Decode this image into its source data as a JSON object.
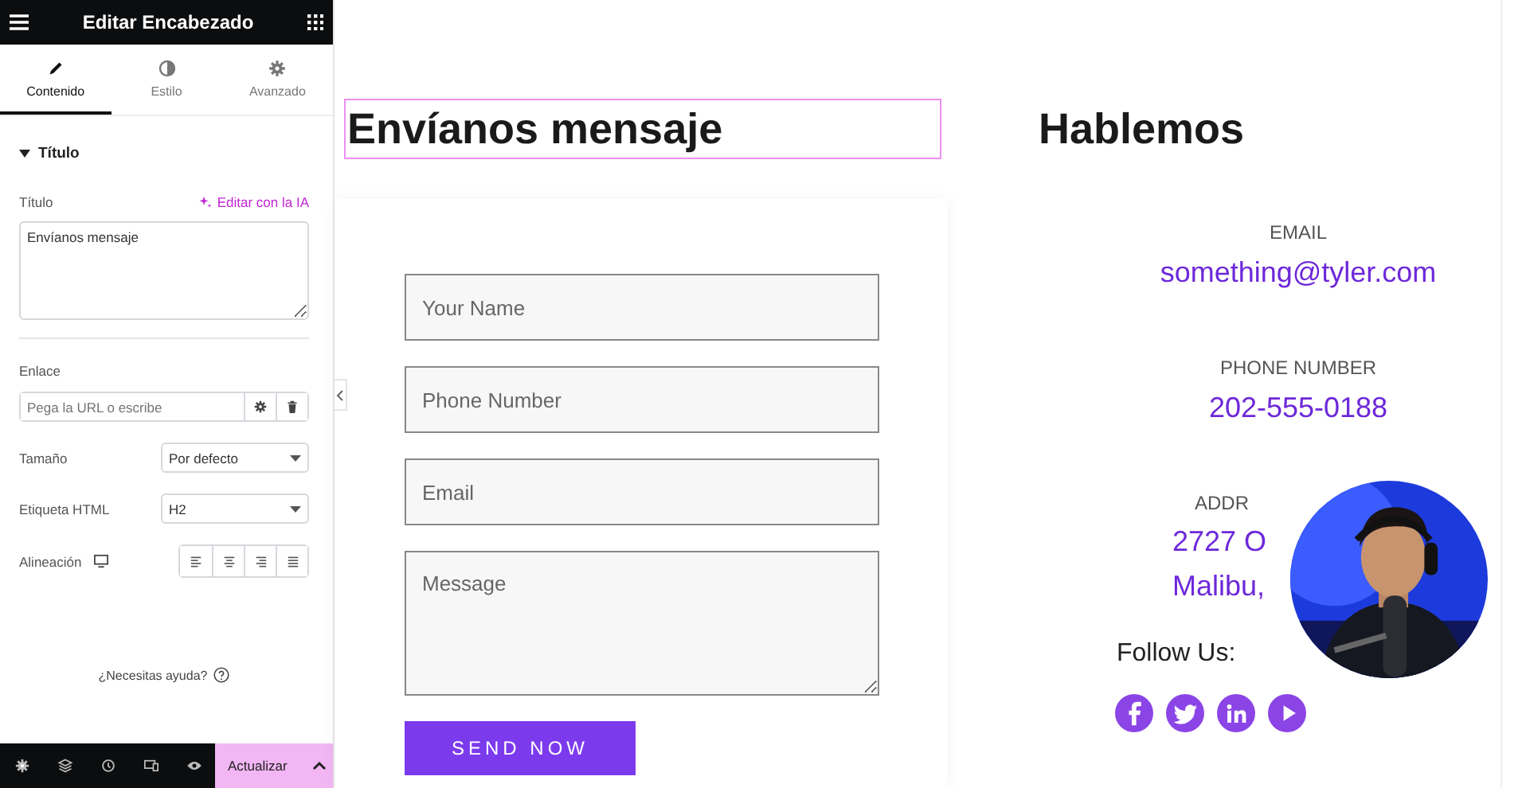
{
  "panel": {
    "title": "Editar Encabezado",
    "tabs": [
      {
        "label": "Contenido",
        "kind": "pencil",
        "selected": true
      },
      {
        "label": "Estilo",
        "kind": "contrast",
        "selected": false
      },
      {
        "label": "Avanzado",
        "kind": "gear",
        "selected": false
      }
    ],
    "section": {
      "title": "Título",
      "expanded": true
    },
    "title_field": {
      "label": "Título",
      "ai_link": "Editar con la IA",
      "value": "Envíanos mensaje"
    },
    "link_field": {
      "label": "Enlace",
      "placeholder": "Pega la URL o escribe"
    },
    "size": {
      "label": "Tamaño",
      "value": "Por defecto"
    },
    "html_tag": {
      "label": "Etiqueta HTML",
      "value": "H2"
    },
    "alignment": {
      "label": "Alineación",
      "options": [
        {
          "kind": "left"
        },
        {
          "kind": "center"
        },
        {
          "kind": "right"
        },
        {
          "kind": "justify"
        }
      ]
    },
    "help": "¿Necesitas ayuda?",
    "footer": {
      "tools": [
        {
          "kind": "gear"
        },
        {
          "kind": "layers"
        },
        {
          "kind": "history"
        },
        {
          "kind": "responsive"
        },
        {
          "kind": "eye"
        }
      ],
      "update_button": "Actualizar"
    }
  },
  "canvas": {
    "form": {
      "heading": "Envíanos mensaje",
      "fields": [
        {
          "kind": "input",
          "placeholder": "Your Name"
        },
        {
          "kind": "input",
          "placeholder": "Phone Number"
        },
        {
          "kind": "input",
          "placeholder": "Email"
        },
        {
          "kind": "textarea",
          "placeholder": "Message"
        }
      ],
      "submit": "SEND NOW"
    },
    "contact": {
      "heading": "Hablemos",
      "items": [
        {
          "label": "EMAIL",
          "lines": [
            "something@tyler.com"
          ]
        },
        {
          "label": "PHONE NUMBER",
          "lines": [
            "202-555-0188"
          ]
        },
        {
          "label": "ADDR",
          "lines": [
            "2727 O",
            "Malibu,"
          ]
        }
      ],
      "follow": "Follow Us:",
      "social": [
        {
          "kind": "facebook"
        },
        {
          "kind": "twitter"
        },
        {
          "kind": "linkedin"
        },
        {
          "kind": "play"
        }
      ]
    }
  }
}
